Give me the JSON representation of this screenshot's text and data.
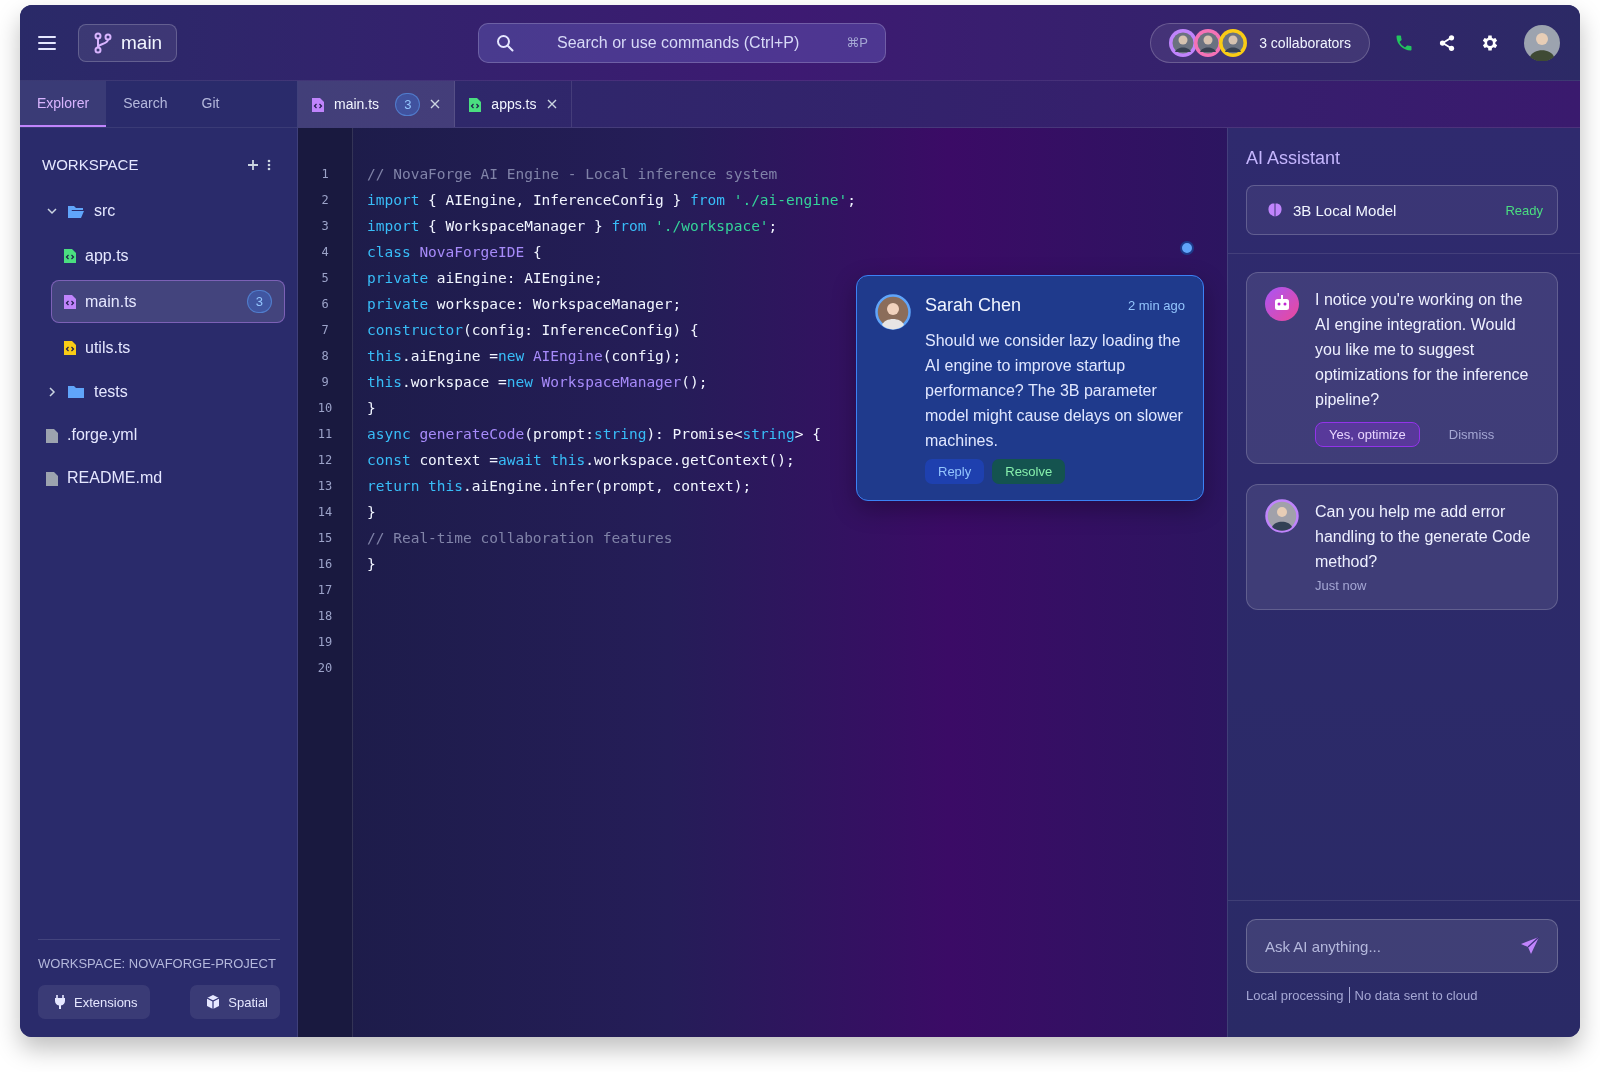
{
  "topbar": {
    "branch": "main",
    "search": {
      "placeholder": "Search or use commands (Ctrl+P)",
      "shortcut": "⌘P"
    },
    "collaborators": {
      "avatars": [
        {
          "color": "#c084fc"
        },
        {
          "color": "#f472b6"
        },
        {
          "color": "#facc15"
        }
      ],
      "label": "3 collaborators"
    }
  },
  "sidebar": {
    "tabs": [
      {
        "label": "Explorer",
        "selected": true
      },
      {
        "label": "Search",
        "selected": false
      },
      {
        "label": "Git",
        "selected": false
      }
    ],
    "title": "WORKSPACE",
    "tree": [
      {
        "kind": "folder",
        "label": "src",
        "expanded": true,
        "children": [
          {
            "kind": "file",
            "label": "app.ts",
            "color": "#4ade80",
            "selected": false
          },
          {
            "kind": "file",
            "label": "main.ts",
            "color": "#c084fc",
            "selected": true,
            "badge": "3"
          },
          {
            "kind": "file",
            "label": "utils.ts",
            "color": "#facc15",
            "selected": false
          }
        ]
      },
      {
        "kind": "folder",
        "label": "tests",
        "expanded": false
      },
      {
        "kind": "file",
        "label": ".forge.yml",
        "color": "#9ca3af"
      },
      {
        "kind": "file",
        "label": "README.md",
        "color": "#9ca3af"
      }
    ],
    "workspace_label": "WORKSPACE: NOVAFORGE-PROJECT",
    "buttons": [
      {
        "kind": "plug",
        "label": "Extensions"
      },
      {
        "kind": "cube",
        "label": "Spatial"
      }
    ]
  },
  "editor": {
    "tabs": [
      {
        "label": "main.ts",
        "color": "#c084fc",
        "badge": "3",
        "selected": true
      },
      {
        "label": "apps.ts",
        "color": "#4ade80",
        "selected": false
      }
    ],
    "line_numbers": [
      "1",
      "2",
      "3",
      "4",
      "5",
      "6",
      "7",
      "8",
      "9",
      "10",
      "11",
      "12",
      "13",
      "14",
      "15",
      "16",
      "17",
      "18",
      "19",
      "20"
    ],
    "lines": [
      [
        {
          "kind": "comment",
          "text": "// NovaForge AI Engine - Local inference system"
        }
      ],
      [
        {
          "kind": "keyword",
          "text": "import"
        },
        {
          "kind": "plain",
          "text": " { AIEngine, InferenceConfig } "
        },
        {
          "kind": "keyword",
          "text": "from"
        },
        {
          "kind": "string",
          "text": " './ai-engine'"
        },
        {
          "kind": "plain",
          "text": ";"
        }
      ],
      [
        {
          "kind": "keyword",
          "text": "import"
        },
        {
          "kind": "plain",
          "text": " { WorkspaceManager } "
        },
        {
          "kind": "keyword",
          "text": "from"
        },
        {
          "kind": "string",
          "text": " './workspace'"
        },
        {
          "kind": "plain",
          "text": ";"
        }
      ],
      [
        {
          "kind": "keyword",
          "text": "class"
        },
        {
          "kind": "type",
          "text": " NovaForgeIDE"
        },
        {
          "kind": "plain",
          "text": " {"
        }
      ],
      [
        {
          "kind": "keyword",
          "text": "private"
        },
        {
          "kind": "plain",
          "text": " aiEngine: AIEngine;"
        }
      ],
      [
        {
          "kind": "keyword",
          "text": "private"
        },
        {
          "kind": "plain",
          "text": " workspace: WorkspaceManager;"
        }
      ],
      [
        {
          "kind": "keyword",
          "text": "constructor"
        },
        {
          "kind": "plain",
          "text": "(config: InferenceConfig) {"
        }
      ],
      [
        {
          "kind": "keyword",
          "text": "this"
        },
        {
          "kind": "plain",
          "text": ".aiEngine ="
        },
        {
          "kind": "keyword",
          "text": "new"
        },
        {
          "kind": "type",
          "text": " AIEngine"
        },
        {
          "kind": "plain",
          "text": "(config);"
        }
      ],
      [
        {
          "kind": "keyword",
          "text": "this"
        },
        {
          "kind": "plain",
          "text": ".workspace ="
        },
        {
          "kind": "keyword",
          "text": "new"
        },
        {
          "kind": "type",
          "text": " WorkspaceManager"
        },
        {
          "kind": "plain",
          "text": "();"
        }
      ],
      [
        {
          "kind": "plain",
          "text": "}"
        }
      ],
      [
        {
          "kind": "keyword",
          "text": "async"
        },
        {
          "kind": "type",
          "text": " generateCode"
        },
        {
          "kind": "plain",
          "text": "(prompt:"
        },
        {
          "kind": "keyword",
          "text": "string"
        },
        {
          "kind": "plain",
          "text": "): Promise<"
        },
        {
          "kind": "keyword",
          "text": "string"
        },
        {
          "kind": "plain",
          "text": "> {"
        }
      ],
      [
        {
          "kind": "keyword",
          "text": "const"
        },
        {
          "kind": "plain",
          "text": " context ="
        },
        {
          "kind": "keyword",
          "text": "await this"
        },
        {
          "kind": "plain",
          "text": ".workspace.getContext();"
        }
      ],
      [
        {
          "kind": "keyword",
          "text": "return this"
        },
        {
          "kind": "plain",
          "text": ".aiEngine.infer(prompt, context);"
        }
      ],
      [
        {
          "kind": "plain",
          "text": "}"
        }
      ],
      [
        {
          "kind": "comment",
          "text": "// Real-time collaboration features"
        }
      ],
      [
        {
          "kind": "plain",
          "text": "}"
        }
      ]
    ],
    "comment": {
      "author": "Sarah Chen",
      "time": "2 min ago",
      "text": "Should we consider lazy loading the AI engine to improve startup performance? The 3B parameter model might cause delays on slower machines.",
      "actions": [
        {
          "kind": "reply",
          "label": "Reply"
        },
        {
          "kind": "resolve",
          "label": "Resolve"
        }
      ]
    }
  },
  "assistant": {
    "title": "AI Assistant",
    "model": {
      "name": "3B Local Model",
      "status": "Ready"
    },
    "messages": [
      {
        "kind": "ai",
        "text": "I notice you're working on the AI engine integration. Would you like me to suggest optimizations for the inference pipeline?",
        "actions": [
          {
            "kind": "primary",
            "label": "Yes, optimize"
          },
          {
            "kind": "secondary",
            "label": "Dismiss"
          }
        ]
      },
      {
        "kind": "user",
        "text": "Can you help me add error handling to the generate Code method?",
        "time": "Just now"
      }
    ],
    "input": {
      "placeholder": "Ask AI anything..."
    },
    "footer": [
      "Local processing",
      "No data sent to cloud"
    ]
  }
}
